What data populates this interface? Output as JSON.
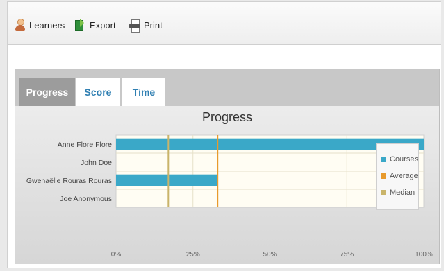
{
  "toolbar": {
    "learners_label": "Learners",
    "export_label": "Export",
    "print_label": "Print"
  },
  "tabs": [
    {
      "label": "Progress"
    },
    {
      "label": "Score"
    },
    {
      "label": "Time"
    }
  ],
  "colors": {
    "courses": "#3aa8c8",
    "average": "#e89a2c",
    "median": "#c9b46a"
  },
  "chart_data": {
    "type": "bar",
    "title": "Progress",
    "categories": [
      "Anne Flore Flore",
      "John Doe",
      "Gwenaëlle Rouras Rouras",
      "Joe Anonymous"
    ],
    "series": [
      {
        "name": "Courses",
        "values": [
          100,
          0,
          33,
          0
        ]
      }
    ],
    "reference_lines": [
      {
        "name": "Average",
        "value": 33
      },
      {
        "name": "Median",
        "value": 17
      }
    ],
    "x_ticks": [
      "0%",
      "25%",
      "50%",
      "75%",
      "100%"
    ],
    "xlim": [
      0,
      100
    ],
    "legend": "right",
    "grid": true
  }
}
